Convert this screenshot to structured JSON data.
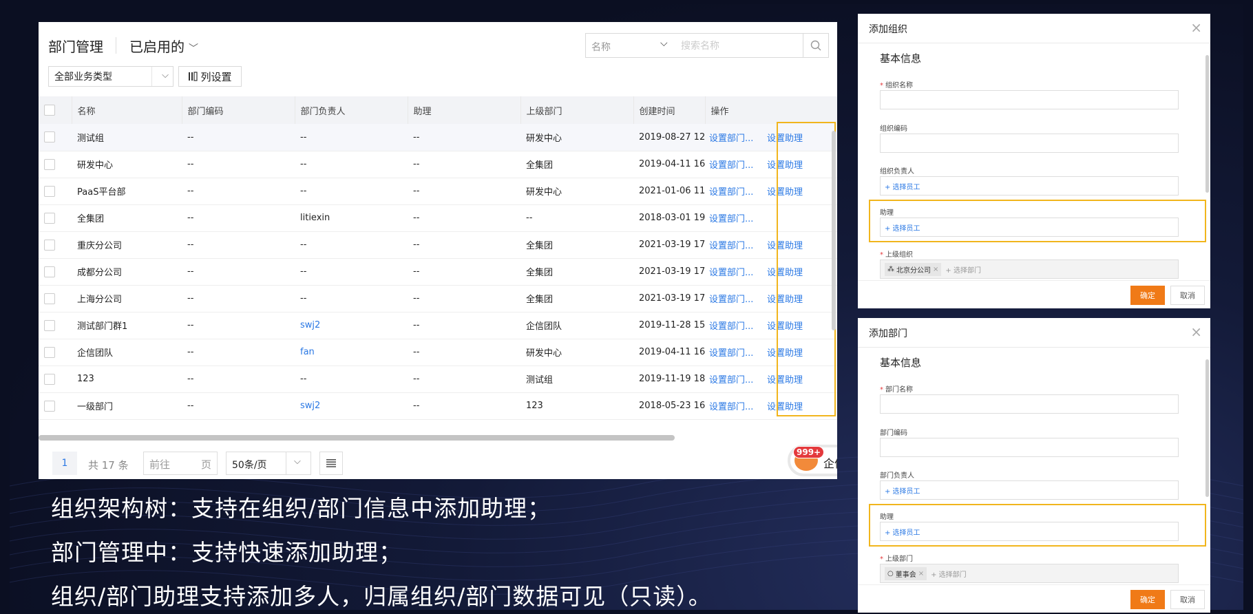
{
  "header": {
    "title": "部门管理",
    "filter_label": "已启用的",
    "search_field": "名称",
    "search_placeholder": "搜索名称",
    "type_select": "全部业务类型",
    "column_settings": "列设置"
  },
  "table": {
    "columns": [
      "名称",
      "部门编码",
      "部门负责人",
      "助理",
      "上级部门",
      "创建时间",
      "操作"
    ],
    "rows": [
      {
        "name": "测试组",
        "code": "--",
        "manager": "--",
        "assistant": "--",
        "parent": "研发中心",
        "created": "2019-08-27 12:",
        "action1": "设置部门...",
        "action2": "设置助理"
      },
      {
        "name": "研发中心",
        "code": "--",
        "manager": "--",
        "assistant": "--",
        "parent": "全集团",
        "created": "2019-04-11 16:",
        "action1": "设置部门...",
        "action2": "设置助理"
      },
      {
        "name": "PaaS平台部",
        "code": "--",
        "manager": "--",
        "assistant": "--",
        "parent": "研发中心",
        "created": "2021-01-06 11:",
        "action1": "设置部门...",
        "action2": "设置助理"
      },
      {
        "name": "全集团",
        "code": "--",
        "manager": "litiexin",
        "assistant": "--",
        "parent": "--",
        "created": "2018-03-01 19:",
        "action1": "设置部门...",
        "action2": ""
      },
      {
        "name": "重庆分公司",
        "code": "--",
        "manager": "--",
        "assistant": "--",
        "parent": "全集团",
        "created": "2021-03-19 17:",
        "action1": "设置部门...",
        "action2": "设置助理"
      },
      {
        "name": "成都分公司",
        "code": "--",
        "manager": "--",
        "assistant": "--",
        "parent": "全集团",
        "created": "2021-03-19 17:",
        "action1": "设置部门...",
        "action2": "设置助理"
      },
      {
        "name": "上海分公司",
        "code": "--",
        "manager": "--",
        "assistant": "--",
        "parent": "全集团",
        "created": "2021-03-19 17:",
        "action1": "设置部门...",
        "action2": "设置助理"
      },
      {
        "name": "测试部门群1",
        "code": "--",
        "manager": "swj2",
        "assistant": "--",
        "parent": "企信团队",
        "created": "2019-11-28 15:",
        "action1": "设置部门...",
        "action2": "设置助理"
      },
      {
        "name": "企信团队",
        "code": "--",
        "manager": "fan",
        "assistant": "--",
        "parent": "研发中心",
        "created": "2019-04-11 16:",
        "action1": "设置部门...",
        "action2": "设置助理"
      },
      {
        "name": "123",
        "code": "--",
        "manager": "--",
        "assistant": "--",
        "parent": "测试组",
        "created": "2019-11-19 18:",
        "action1": "设置部门...",
        "action2": "设置助理"
      },
      {
        "name": "一级部门",
        "code": "--",
        "manager": "swj2",
        "assistant": "--",
        "parent": "123",
        "created": "2018-05-23 16:",
        "action1": "设置部门...",
        "action2": "设置助理"
      }
    ]
  },
  "pager": {
    "current_page": "1",
    "total": "共 17 条",
    "goto_prefix": "前往",
    "goto_suffix": "页",
    "page_size": "50条/页"
  },
  "chat": {
    "badge": "999+",
    "label": "企信"
  },
  "captions": [
    "组织架构树：支持在组织/部门信息中添加助理；",
    "部门管理中：支持快速添加助理；",
    "组织/部门助理支持添加多人，归属组织/部门数据可见（只读）。"
  ],
  "dialog_org": {
    "title": "添加组织",
    "section": "基本信息",
    "name_label": "组织名称",
    "code_label": "组织编码",
    "manager_label": "组织负责人",
    "manager_value": "+ 选择员工",
    "assistant_label": "助理",
    "assistant_value": "+ 选择员工",
    "parent_label": "上级组织",
    "parent_tag": "北京分公司",
    "parent_add": "+ 选择部门",
    "ok": "确定",
    "cancel": "取消"
  },
  "dialog_dept": {
    "title": "添加部门",
    "section": "基本信息",
    "name_label": "部门名称",
    "code_label": "部门编码",
    "manager_label": "部门负责人",
    "manager_value": "+ 选择员工",
    "assistant_label": "助理",
    "assistant_value": "+ 选择员工",
    "parent_label": "上级部门",
    "parent_tag": "董事会",
    "parent_add": "+ 选择部门",
    "ok": "确定",
    "cancel": "取消"
  },
  "colors": {
    "link": "#2a78e4",
    "highlight": "#f1b51c",
    "primary_button": "#f07a17",
    "background": "#0b0f22"
  }
}
